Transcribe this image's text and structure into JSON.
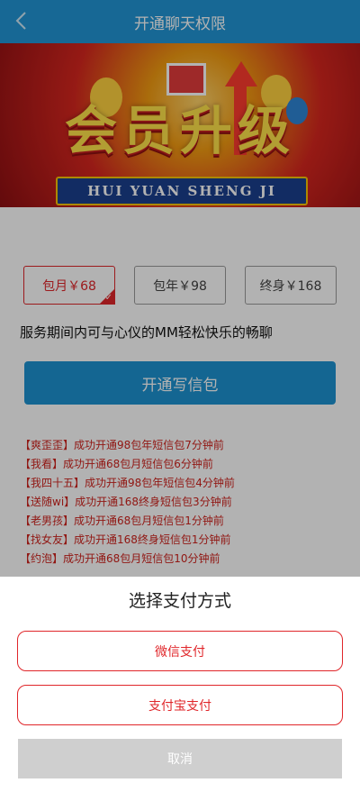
{
  "header": {
    "title": "开通聊天权限",
    "back_icon": "chevron-left-icon"
  },
  "banner": {
    "headline": "会员升级",
    "pinyin": "HUI YUAN SHENG JI"
  },
  "plans": [
    {
      "label": "包月￥68",
      "selected": true
    },
    {
      "label": "包年￥98",
      "selected": false
    },
    {
      "label": "终身￥168",
      "selected": false
    }
  ],
  "description": "服务期间内可与心仪的MM轻松快乐的畅聊",
  "open_button": "开通写信包",
  "feed": [
    "【爽歪歪】成功开通98包年短信包7分钟前",
    "【我看】成功开通68包月短信包6分钟前",
    "【我四十五】成功开通98包年短信包4分钟前",
    "【送随wi】成功开通168终身短信包3分钟前",
    "【老男孩】成功开通68包月短信包1分钟前",
    "【找女友】成功开通168终身短信包1分钟前",
    "【约泡】成功开通68包月短信包10分钟前"
  ],
  "payment_sheet": {
    "title": "选择支付方式",
    "wechat": "微信支付",
    "alipay": "支付宝支付",
    "cancel": "取消"
  },
  "colors": {
    "primary": "#2196d6",
    "accent": "#e0262a"
  }
}
